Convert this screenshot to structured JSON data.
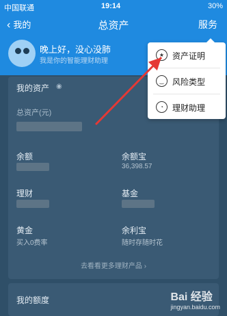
{
  "status_bar": {
    "carrier": "中国联通",
    "time": "19:14",
    "battery": "30%"
  },
  "nav": {
    "back_label": "我的",
    "title": "总资产",
    "service": "服务"
  },
  "greeting": {
    "line1": "晚上好，没心没肺",
    "line2": "我是你的智能理财助理"
  },
  "assets_card": {
    "title": "我的资产",
    "total_label": "总资产(元)",
    "items": [
      {
        "label": "余额",
        "sub": ""
      },
      {
        "label": "余额宝",
        "sub": "36,398.57"
      },
      {
        "label": "理财",
        "sub": ""
      },
      {
        "label": "基金",
        "sub": ""
      },
      {
        "label": "黄金",
        "sub": "买入0费率"
      },
      {
        "label": "余利宝",
        "sub": "随时存随时花"
      }
    ],
    "more": "去看看更多理财产品 ›"
  },
  "quota": {
    "title": "我的额度"
  },
  "menu": {
    "items": [
      {
        "label": "资产证明",
        "icon": "star-icon"
      },
      {
        "label": "风险类型",
        "icon": "smile-icon"
      },
      {
        "label": "理财助理",
        "icon": "robot-icon"
      }
    ]
  },
  "watermark": {
    "brand": "Bai 经验",
    "url": "jingyan.baidu.com"
  },
  "colors": {
    "header": "#1f8ae0",
    "annotation_arrow": "#e53935"
  }
}
